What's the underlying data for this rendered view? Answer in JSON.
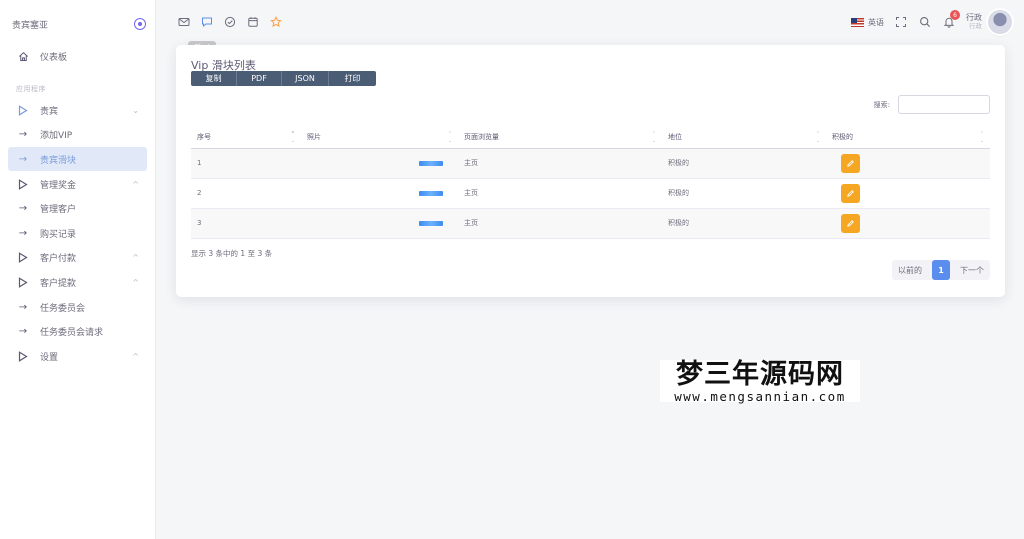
{
  "sidebar": {
    "brand": "贵宾塞亚",
    "section_label": "应用程序",
    "items": [
      {
        "label": "仪表板",
        "icon": "home-icon"
      },
      {
        "label": "贵宾",
        "icon": "play-outline-icon"
      },
      {
        "label": "添加VIP",
        "icon": "arrow-right-icon"
      },
      {
        "label": "贵宾滑块",
        "icon": "arrow-right-icon"
      },
      {
        "label": "管理奖金",
        "icon": "play-outline-icon"
      },
      {
        "label": "管理客户",
        "icon": "arrow-right-icon"
      },
      {
        "label": "购买记录",
        "icon": "arrow-right-icon"
      },
      {
        "label": "客户付款",
        "icon": "play-outline-icon"
      },
      {
        "label": "客户提款",
        "icon": "play-outline-icon"
      },
      {
        "label": "任务委员会",
        "icon": "arrow-right-icon"
      },
      {
        "label": "任务委员会请求",
        "icon": "arrow-right-icon"
      },
      {
        "label": "设置",
        "icon": "play-outline-icon"
      }
    ]
  },
  "topbar": {
    "tooltip": "Chat",
    "language": "英语",
    "notification_count": "6",
    "user_name": "行政",
    "user_role": "行政"
  },
  "card": {
    "title": "Vip 滑块列表",
    "buttons": {
      "copy": "复制",
      "pdf": "PDF",
      "json": "JSON",
      "print": "打印"
    },
    "search_label": "搜索:",
    "search_value": "",
    "columns": [
      "序号",
      "照片",
      "页面浏览量",
      "地位",
      "积极的"
    ],
    "rows": [
      {
        "id": "1",
        "page": "主页",
        "status": "积极的"
      },
      {
        "id": "2",
        "page": "主页",
        "status": "积极的"
      },
      {
        "id": "3",
        "page": "主页",
        "status": "积极的"
      }
    ],
    "info": "显示 3 条中的 1 至 3 条",
    "pagination": {
      "prev": "以前的",
      "current": "1",
      "next": "下一个"
    }
  },
  "colors": {
    "accent": "#7367f0",
    "button_dark": "#4b5c75",
    "edit": "#f5a623",
    "page_active": "#5a8dee",
    "badge": "#ea5455"
  },
  "watermark": {
    "cn": "梦三年源码网",
    "en": "www.mengsannian.com"
  }
}
